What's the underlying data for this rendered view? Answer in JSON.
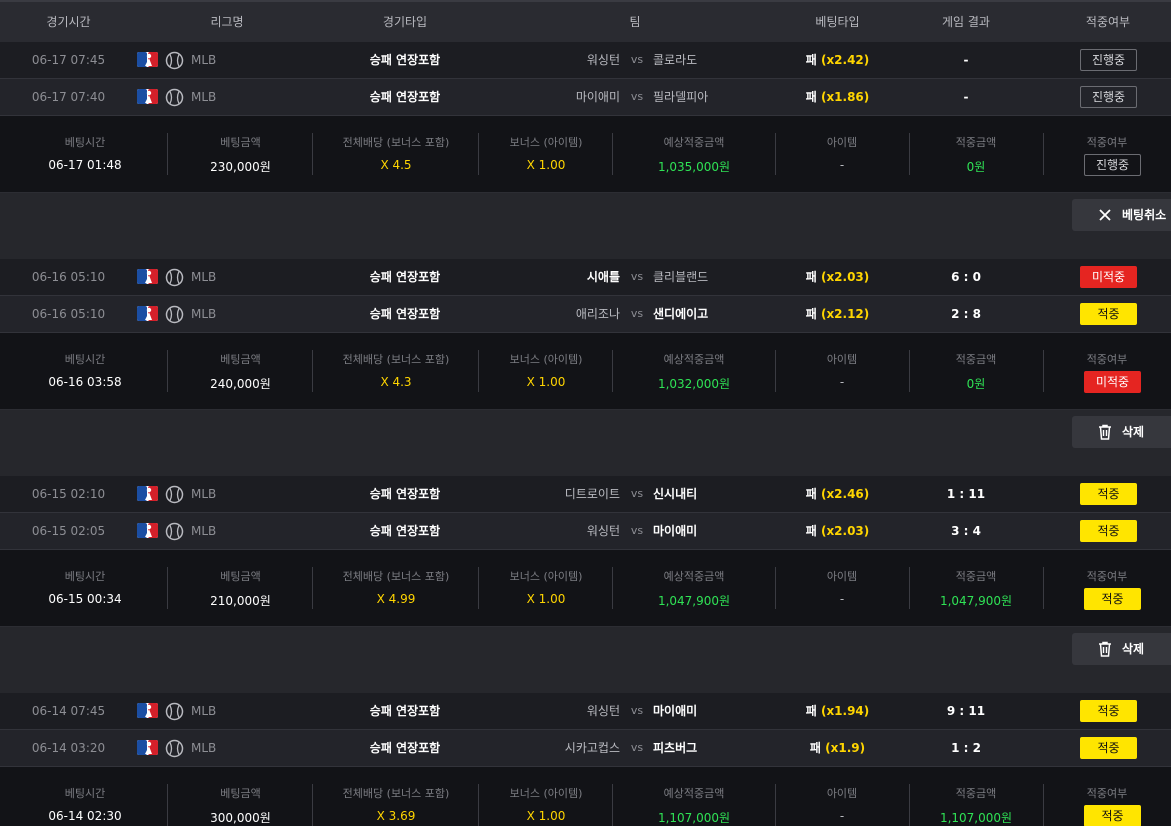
{
  "header": {
    "cols": [
      "경기시간",
      "리그명",
      "경기타입",
      "팀",
      "베팅타입",
      "게임 결과",
      "적중여부"
    ]
  },
  "summary_labels": {
    "bet_time": "베팅시간",
    "bet_amount": "베팅금액",
    "total_odds": "전체배당 (보너스 포함)",
    "bonus": "보너스 (아이템)",
    "expected": "예상적중금액",
    "item": "아이템",
    "win_amount": "적중금액",
    "hit": "적중여부"
  },
  "colors": {
    "yellow": "#ffd500",
    "green": "#2fe255",
    "red": "#e52521",
    "win_badge": "#ffe500"
  },
  "bets": [
    {
      "matches": [
        {
          "time": "06-17 07:45",
          "league": "MLB",
          "game_type": "승패 연장포함",
          "home": "워싱턴",
          "vs": "vs",
          "away": "콜로라도",
          "pick": "패",
          "odds": "(x2.42)",
          "result": "-",
          "status": "진행중",
          "status_kind": "progress",
          "winner": ""
        },
        {
          "time": "06-17 07:40",
          "league": "MLB",
          "game_type": "승패 연장포함",
          "home": "마이애미",
          "vs": "vs",
          "away": "필라델피아",
          "pick": "패",
          "odds": "(x1.86)",
          "result": "-",
          "status": "진행중",
          "status_kind": "progress",
          "winner": ""
        }
      ],
      "summary": {
        "bet_time": "06-17 01:48",
        "bet_amount": "230,000원",
        "total_odds": "X 4.5",
        "bonus": "X 1.00",
        "expected": "1,035,000원",
        "item": "-",
        "win_amount": "0원",
        "hit": "진행중",
        "hit_kind": "progress"
      },
      "action": {
        "label": "베팅취소",
        "icon": "close-icon"
      }
    },
    {
      "matches": [
        {
          "time": "06-16 05:10",
          "league": "MLB",
          "game_type": "승패 연장포함",
          "home": "시애틀",
          "vs": "vs",
          "away": "클리블랜드",
          "pick": "패",
          "odds": "(x2.03)",
          "result": "6 : 0",
          "status": "미적중",
          "status_kind": "lose",
          "winner": "home"
        },
        {
          "time": "06-16 05:10",
          "league": "MLB",
          "game_type": "승패 연장포함",
          "home": "애리조나",
          "vs": "vs",
          "away": "샌디에이고",
          "pick": "패",
          "odds": "(x2.12)",
          "result": "2 : 8",
          "status": "적중",
          "status_kind": "win",
          "winner": "away"
        }
      ],
      "summary": {
        "bet_time": "06-16 03:58",
        "bet_amount": "240,000원",
        "total_odds": "X 4.3",
        "bonus": "X 1.00",
        "expected": "1,032,000원",
        "item": "-",
        "win_amount": "0원",
        "hit": "미적중",
        "hit_kind": "lose"
      },
      "action": {
        "label": "삭제",
        "icon": "trash-icon"
      }
    },
    {
      "matches": [
        {
          "time": "06-15 02:10",
          "league": "MLB",
          "game_type": "승패 연장포함",
          "home": "디트로이트",
          "vs": "vs",
          "away": "신시내티",
          "pick": "패",
          "odds": "(x2.46)",
          "result": "1 : 11",
          "status": "적중",
          "status_kind": "win",
          "winner": "away"
        },
        {
          "time": "06-15 02:05",
          "league": "MLB",
          "game_type": "승패 연장포함",
          "home": "워싱턴",
          "vs": "vs",
          "away": "마이애미",
          "pick": "패",
          "odds": "(x2.03)",
          "result": "3 : 4",
          "status": "적중",
          "status_kind": "win",
          "winner": "away"
        }
      ],
      "summary": {
        "bet_time": "06-15 00:34",
        "bet_amount": "210,000원",
        "total_odds": "X 4.99",
        "bonus": "X 1.00",
        "expected": "1,047,900원",
        "item": "-",
        "win_amount": "1,047,900원",
        "hit": "적중",
        "hit_kind": "win"
      },
      "action": {
        "label": "삭제",
        "icon": "trash-icon"
      }
    },
    {
      "matches": [
        {
          "time": "06-14 07:45",
          "league": "MLB",
          "game_type": "승패 연장포함",
          "home": "워싱턴",
          "vs": "vs",
          "away": "마이애미",
          "pick": "패",
          "odds": "(x1.94)",
          "result": "9 : 11",
          "status": "적중",
          "status_kind": "win",
          "winner": "away"
        },
        {
          "time": "06-14 03:20",
          "league": "MLB",
          "game_type": "승패 연장포함",
          "home": "시카고컵스",
          "vs": "vs",
          "away": "피츠버그",
          "pick": "패",
          "odds": "(x1.9)",
          "result": "1 : 2",
          "status": "적중",
          "status_kind": "win",
          "winner": "away"
        }
      ],
      "summary": {
        "bet_time": "06-14 02:30",
        "bet_amount": "300,000원",
        "total_odds": "X 3.69",
        "bonus": "X 1.00",
        "expected": "1,107,000원",
        "item": "-",
        "win_amount": "1,107,000원",
        "hit": "적중",
        "hit_kind": "win"
      },
      "action": null
    }
  ]
}
